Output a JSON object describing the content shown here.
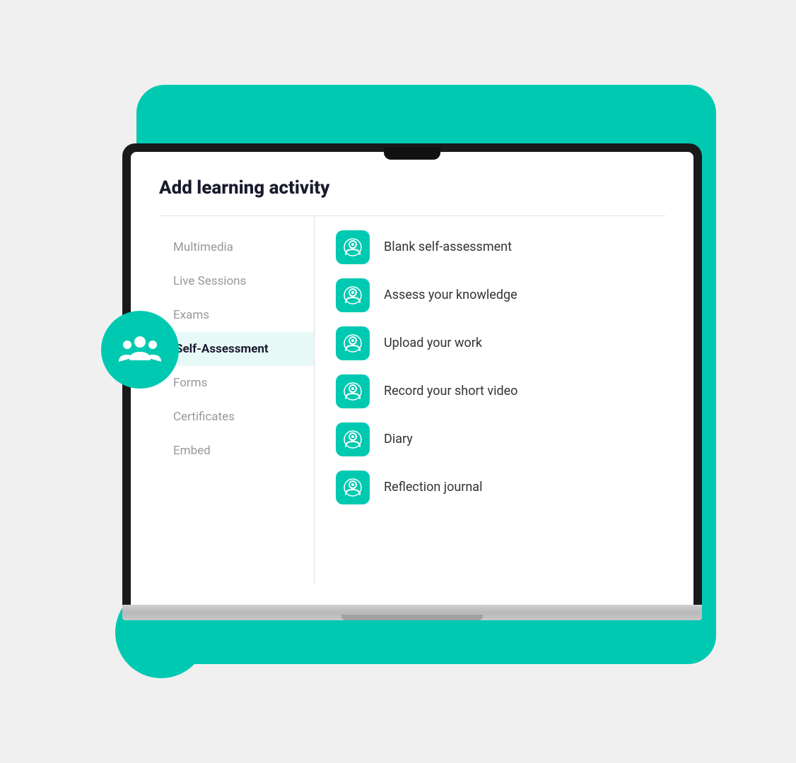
{
  "scene": {
    "colors": {
      "teal": "#00c9b1",
      "dark": "#1a1a2e",
      "gray": "#999999",
      "white": "#ffffff",
      "light_bg": "#e8faf8"
    }
  },
  "dialog": {
    "title": "Add learning activity",
    "nav_items": [
      {
        "id": "multimedia",
        "label": "Multimedia",
        "active": false
      },
      {
        "id": "live-sessions",
        "label": "Live Sessions",
        "active": false
      },
      {
        "id": "exams",
        "label": "Exams",
        "active": false
      },
      {
        "id": "self-assessment",
        "label": "Self-Assessment",
        "active": true
      },
      {
        "id": "forms",
        "label": "Forms",
        "active": false
      },
      {
        "id": "certificates",
        "label": "Certificates",
        "active": false
      },
      {
        "id": "embed",
        "label": "Embed",
        "active": false
      }
    ],
    "activities": [
      {
        "id": "blank-self-assessment",
        "label": "Blank self-assessment"
      },
      {
        "id": "assess-knowledge",
        "label": "Assess your knowledge"
      },
      {
        "id": "upload-work",
        "label": "Upload your work"
      },
      {
        "id": "record-video",
        "label": "Record your short video"
      },
      {
        "id": "diary",
        "label": "Diary"
      },
      {
        "id": "reflection-journal",
        "label": "Reflection journal"
      }
    ]
  }
}
